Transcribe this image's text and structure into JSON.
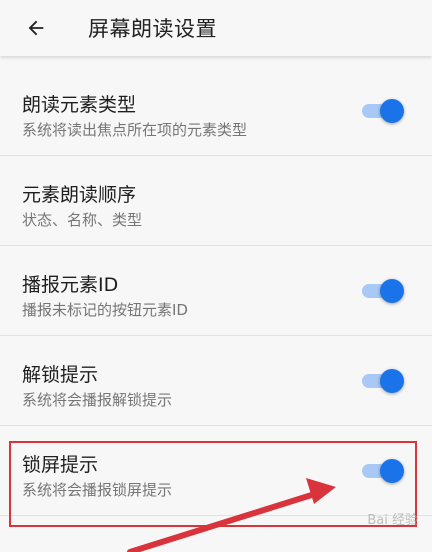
{
  "header": {
    "title": "屏幕朗读设置",
    "back_icon": "arrow-left-icon"
  },
  "settings": [
    {
      "title": "朗读元素类型",
      "subtitle": "系统将读出焦点所在项的元素类型",
      "toggle": true
    },
    {
      "title": "元素朗读顺序",
      "subtitle": "状态、名称、类型",
      "toggle": false
    },
    {
      "title": "播报元素ID",
      "subtitle": "播报未标记的按钮元素ID",
      "toggle": true
    },
    {
      "title": "解锁提示",
      "subtitle": "系统将会播报解锁提示",
      "toggle": true
    },
    {
      "title": "锁屏提示",
      "subtitle": "系统将会播报锁屏提示",
      "toggle": true
    }
  ],
  "colors": {
    "accent": "#1a73e8",
    "track": "#a8c8f5",
    "annotation": "#d9343b"
  },
  "watermark": {
    "text": "Bai 经验"
  }
}
